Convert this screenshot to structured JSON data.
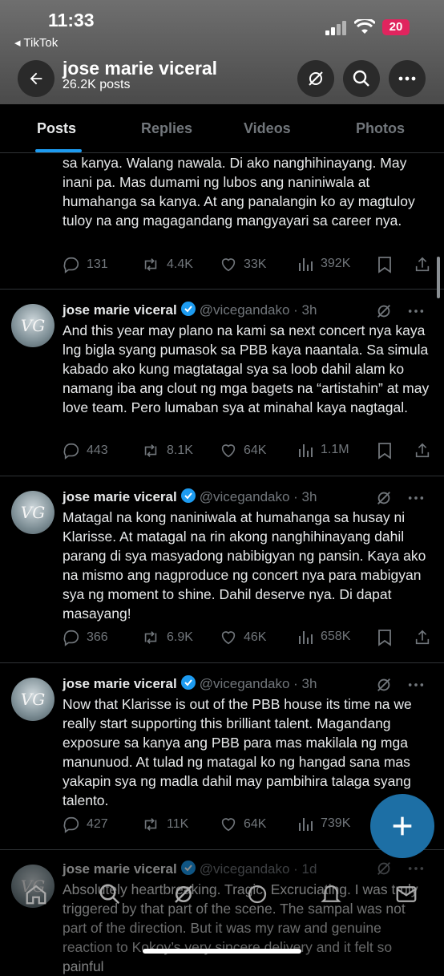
{
  "status_bar": {
    "time": "11:33",
    "back_app": "◂ TikTok",
    "battery": "20"
  },
  "header": {
    "name": "jose marie viceral",
    "posts_count": "26.2K posts"
  },
  "tabs": [
    {
      "label": "Posts"
    },
    {
      "label": "Replies"
    },
    {
      "label": "Videos"
    },
    {
      "label": "Photos"
    }
  ],
  "posts": [
    {
      "text": "sa kanya. Walang nawala. Di ako nanghihinayang. May inani pa. Mas dumami ng lubos ang naniniwala at humahanga sa kanya. At ang panalangin ko ay magtuloy tuloy na ang magagandang mangyayari sa career nya.",
      "replies": "131",
      "reposts": "4.4K",
      "likes": "33K",
      "views": "392K"
    },
    {
      "name": "jose marie viceral",
      "handle": "@vicegandako · 3h",
      "text": "And this year may plano na kami sa next concert nya kaya lng bigla syang pumasok sa PBB kaya naantala. Sa simula kabado ako kung magtatagal sya sa loob dahil alam ko namang iba ang clout ng mga bagets na “artistahin” at may love team. Pero lumaban sya at minahal kaya nagtagal.",
      "replies": "443",
      "reposts": "8.1K",
      "likes": "64K",
      "views": "1.1M"
    },
    {
      "name": "jose marie viceral",
      "handle": "@vicegandako · 3h",
      "text": "Matagal na kong naniniwala at humahanga sa husay ni Klarisse. At matagal na rin akong nanghihinayang dahil parang di sya masyadong nabibigyan ng pansin. Kaya ako na mismo ang nagproduce ng concert nya para mabigyan sya ng moment to shine. Dahil deserve nya. Di dapat masayang!",
      "replies": "366",
      "reposts": "6.9K",
      "likes": "46K",
      "views": "658K"
    },
    {
      "name": "jose marie viceral",
      "handle": "@vicegandako · 3h",
      "text": "Now that Klarisse is out of the PBB house its time na we really start supporting this brilliant talent. Magandang exposure sa kanya ang PBB para mas makilala ng mga manunuod. At tulad ng matagal ko ng hangad sana mas yakapin sya ng madla dahil may pambihira talaga syang talento.",
      "replies": "427",
      "reposts": "11K",
      "likes": "64K",
      "views": "739K"
    },
    {
      "name": "jose marie viceral",
      "handle": "@vicegandako · 1d",
      "text": "Absolutely heartbreaking. Tragic. Excruciating. I was truly triggered by that part of the scene. The sampal was not part of the direction. But it was my raw and genuine reaction to Kokoy’s very sincere delivery and it felt so painful"
    }
  ],
  "avatar_text": "VG",
  "colors": {
    "accent": "#1d9bf0",
    "muted": "#71767b",
    "text": "#e7e9ea",
    "battery": "#e0245e"
  }
}
